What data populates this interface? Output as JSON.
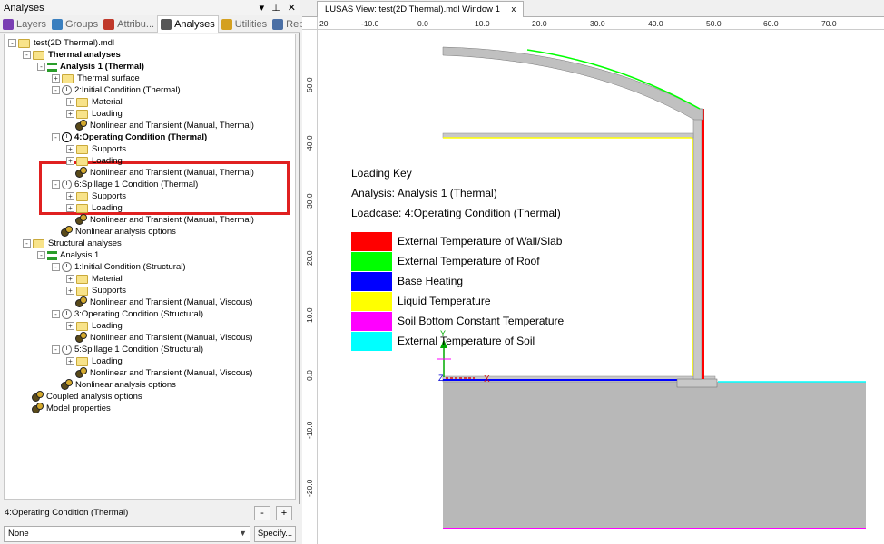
{
  "panel": {
    "title": "Analyses",
    "buttons": [
      "▾",
      "⊥",
      "✕"
    ]
  },
  "tabs": [
    {
      "label": "Layers",
      "color": "#7a3fb3"
    },
    {
      "label": "Groups",
      "color": "#3a7fbf"
    },
    {
      "label": "Attribu...",
      "color": "#c0392b"
    },
    {
      "label": "Analyses",
      "color": "#555555",
      "active": true
    },
    {
      "label": "Utilities",
      "color": "#d4a020"
    },
    {
      "label": "Reports",
      "color": "#4a6fa5"
    }
  ],
  "tree": [
    {
      "label": "test(2D Thermal).mdl",
      "indent": 0,
      "icon": "folder",
      "exp": "-"
    },
    {
      "label": "Thermal analyses",
      "indent": 1,
      "icon": "folder",
      "exp": "-",
      "bold": true
    },
    {
      "label": "Analysis 1 (Thermal)",
      "indent": 2,
      "icon": "analysis",
      "exp": "-",
      "bold": true
    },
    {
      "label": "Thermal surface",
      "indent": 3,
      "icon": "folder",
      "exp": "+"
    },
    {
      "label": "2:Initial Condition (Thermal)",
      "indent": 3,
      "icon": "clock",
      "exp": "-"
    },
    {
      "label": "Material",
      "indent": 4,
      "icon": "folder",
      "exp": "+"
    },
    {
      "label": "Loading",
      "indent": 4,
      "icon": "folder",
      "exp": "+"
    },
    {
      "label": "Nonlinear and Transient (Manual, Thermal)",
      "indent": 4,
      "icon": "gear",
      "exp": ""
    },
    {
      "label": "4:Operating Condition (Thermal)",
      "indent": 3,
      "icon": "clock-dark",
      "exp": "-",
      "bold": true
    },
    {
      "label": "Supports",
      "indent": 4,
      "icon": "folder",
      "exp": "+"
    },
    {
      "label": "Loading",
      "indent": 4,
      "icon": "folder",
      "exp": "+"
    },
    {
      "label": "Nonlinear and Transient (Manual, Thermal)",
      "indent": 4,
      "icon": "gear",
      "exp": ""
    },
    {
      "label": "6:Spillage 1 Condition (Thermal)",
      "indent": 3,
      "icon": "clock",
      "exp": "-"
    },
    {
      "label": "Supports",
      "indent": 4,
      "icon": "folder",
      "exp": "+"
    },
    {
      "label": "Loading",
      "indent": 4,
      "icon": "folder",
      "exp": "+"
    },
    {
      "label": "Nonlinear and Transient (Manual, Thermal)",
      "indent": 4,
      "icon": "gear",
      "exp": ""
    },
    {
      "label": "Nonlinear analysis options",
      "indent": 3,
      "icon": "gear",
      "exp": ""
    },
    {
      "label": "Structural analyses",
      "indent": 1,
      "icon": "folder",
      "exp": "-"
    },
    {
      "label": "Analysis 1",
      "indent": 2,
      "icon": "analysis",
      "exp": "-"
    },
    {
      "label": "1:Initial Condition (Structural)",
      "indent": 3,
      "icon": "clock",
      "exp": "-"
    },
    {
      "label": "Material",
      "indent": 4,
      "icon": "folder",
      "exp": "+"
    },
    {
      "label": "Supports",
      "indent": 4,
      "icon": "folder",
      "exp": "+"
    },
    {
      "label": "Nonlinear and Transient (Manual, Viscous)",
      "indent": 4,
      "icon": "gear",
      "exp": ""
    },
    {
      "label": "3:Operating Condition (Structural)",
      "indent": 3,
      "icon": "clock",
      "exp": "-"
    },
    {
      "label": "Loading",
      "indent": 4,
      "icon": "folder",
      "exp": "+"
    },
    {
      "label": "Nonlinear and Transient (Manual, Viscous)",
      "indent": 4,
      "icon": "gear",
      "exp": ""
    },
    {
      "label": "5:Spillage 1 Condition (Structural)",
      "indent": 3,
      "icon": "clock",
      "exp": "-"
    },
    {
      "label": "Loading",
      "indent": 4,
      "icon": "folder",
      "exp": "+"
    },
    {
      "label": "Nonlinear and Transient (Manual, Viscous)",
      "indent": 4,
      "icon": "gear",
      "exp": ""
    },
    {
      "label": "Nonlinear analysis options",
      "indent": 3,
      "icon": "gear",
      "exp": ""
    },
    {
      "label": "Coupled analysis options",
      "indent": 1,
      "icon": "gear",
      "exp": ""
    },
    {
      "label": "Model properties",
      "indent": 1,
      "icon": "gear",
      "exp": ""
    }
  ],
  "bottom": {
    "current": "4:Operating Condition (Thermal)",
    "minus": "-",
    "plus": "+",
    "combo_value": "None",
    "specify": "Specify..."
  },
  "view": {
    "tab_title": "LUSAS View: test(2D Thermal).mdl Window 1",
    "tab_close": "x",
    "x_ticks": [
      "20",
      "-10.0",
      "0.0",
      "10.0",
      "20.0",
      "30.0",
      "40.0",
      "50.0",
      "60.0",
      "70.0"
    ],
    "y_ticks": [
      "50.0",
      "40.0",
      "30.0",
      "20.0",
      "10.0",
      "0.0",
      "-10.0",
      "-20.0"
    ],
    "axis_y": "Y",
    "axis_x": "X",
    "axis_z": "Z"
  },
  "legend": {
    "title": "Loading Key",
    "analysis": "Analysis: Analysis 1 (Thermal)",
    "loadcase": "Loadcase: 4:Operating Condition (Thermal)",
    "items": [
      {
        "label": "External  Temperature of Wall/Slab",
        "color": "#ff0000"
      },
      {
        "label": "External  Temperature of Roof",
        "color": "#00ff00"
      },
      {
        "label": "Base Heating",
        "color": "#0000ff"
      },
      {
        "label": "Liquid Temperature",
        "color": "#ffff00"
      },
      {
        "label": "Soil Bottom Constant Temperature",
        "color": "#ff00ff"
      },
      {
        "label": "External  Temperature of Soil",
        "color": "#00ffff"
      }
    ]
  }
}
